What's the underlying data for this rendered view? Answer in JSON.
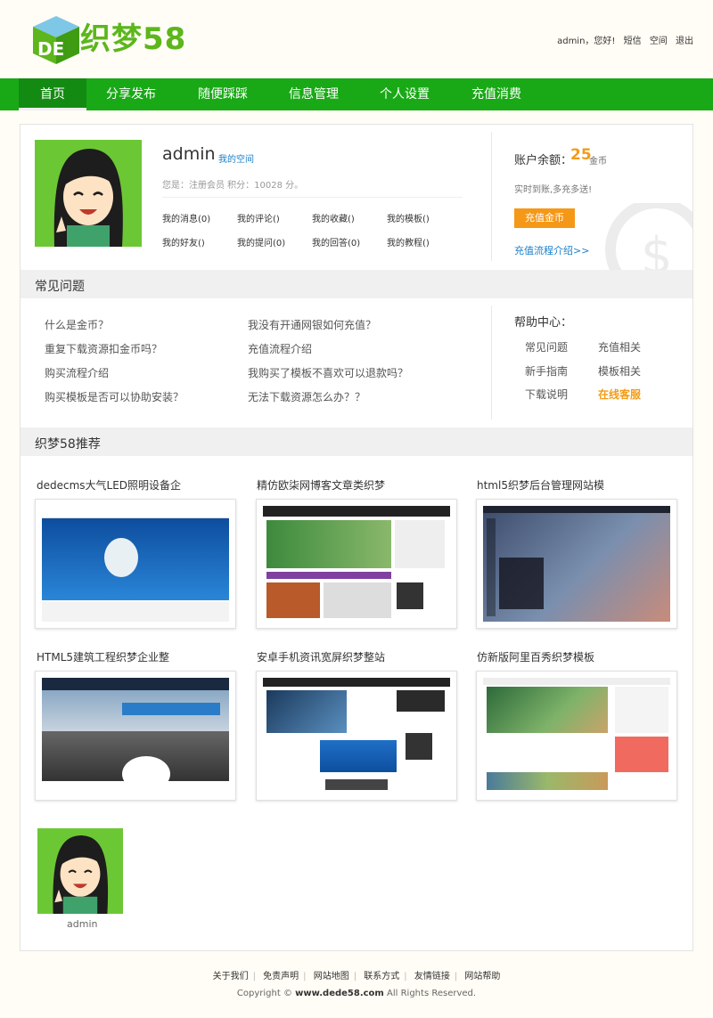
{
  "header": {
    "logo_text": "织梦58",
    "greeting": "admin，您好!",
    "links": [
      "短信",
      "空间",
      "退出"
    ]
  },
  "nav": {
    "items": [
      "首页",
      "分享发布",
      "随便踩踩",
      "信息管理",
      "个人设置",
      "充值消费"
    ],
    "active": "首页"
  },
  "user": {
    "name": "admin",
    "space_link": "我的空间",
    "meta": "您是：注册会员 积分：10028 分。",
    "links": [
      "我的消息(0)",
      "我的评论()",
      "我的收藏()",
      "我的模板()",
      "我的好友()",
      "我的提问(0)",
      "我的回答(0)",
      "我的教程()"
    ]
  },
  "account": {
    "balance_label": "账户余额：",
    "balance_value": "25",
    "balance_unit": "金币",
    "tip": "实时到账,多充多送!",
    "recharge_button": "充值金币",
    "flow_link": "充值流程介绍>>"
  },
  "faq": {
    "title": "常见问题",
    "items": [
      "什么是金币？",
      "我没有开通网银如何充值？",
      "重复下载资源扣金币吗？",
      "充值流程介绍",
      "购买流程介绍",
      "我购买了模板不喜欢可以退款吗？",
      "购买模板是否可以协助安装？",
      "无法下载资源怎么办？？"
    ]
  },
  "help": {
    "title": "帮助中心：",
    "links": [
      "常见问题",
      "充值相关",
      "新手指南",
      "模板相关",
      "下载说明",
      "在线客服"
    ]
  },
  "recommend": {
    "title": "织梦58推荐",
    "items": [
      {
        "title": "dedecms大气LED照明设备企"
      },
      {
        "title": "精仿欧柒网博客文章类织梦"
      },
      {
        "title": "html5织梦后台管理网站模"
      },
      {
        "title": "HTML5建筑工程织梦企业整"
      },
      {
        "title": "安卓手机资讯宽屏织梦整站"
      },
      {
        "title": "仿新版阿里百秀织梦模板"
      }
    ]
  },
  "bottom_user": {
    "name": "admin"
  },
  "footer": {
    "links": [
      "关于我们",
      "免责声明",
      "网站地图",
      "联系方式",
      "友情链接",
      "网站帮助"
    ],
    "copyright_prefix": "Copyright ©",
    "copyright_site": "www.dede58.com",
    "copyright_suffix": "All Rights Reserved."
  },
  "colors": {
    "nav_green": "#19a916",
    "accent_orange": "#f59818",
    "link_blue": "#1a7fc8"
  }
}
